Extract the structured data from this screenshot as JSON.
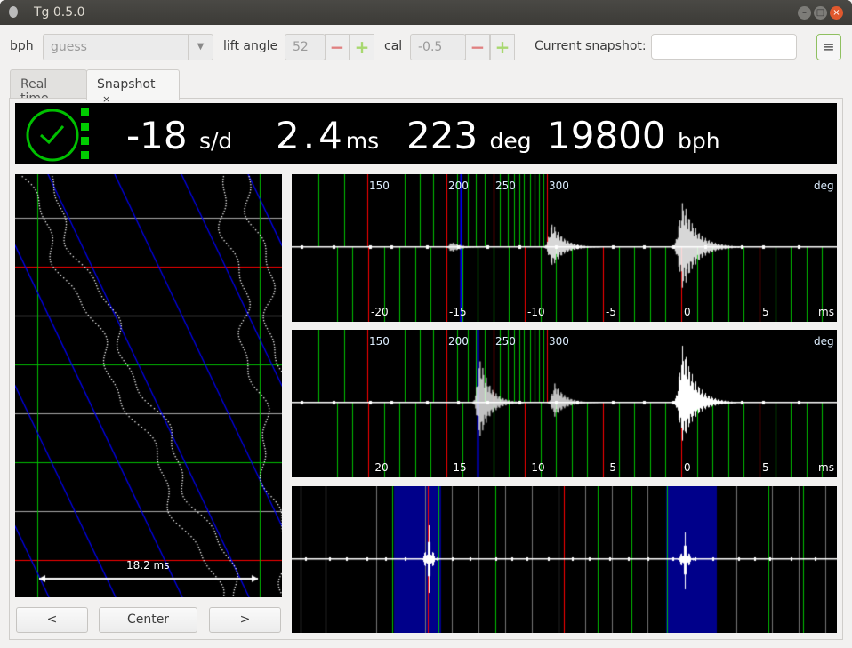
{
  "window": {
    "title": "Tg 0.5.0"
  },
  "toolbar": {
    "bph_label": "bph",
    "bph_value": "guess",
    "lift_angle_label": "lift angle",
    "lift_angle_value": "52",
    "cal_label": "cal",
    "cal_value": "-0.5",
    "snapshot_label": "Current snapshot:",
    "snapshot_value": "",
    "minus": "−",
    "plus": "+",
    "menu": "≡"
  },
  "tabs": [
    {
      "label": "Real time"
    },
    {
      "label": "Snapshot",
      "close": "×"
    }
  ],
  "status": {
    "rate_value": "-18",
    "rate_unit": "s/d",
    "beat_error_value": "2.4",
    "beat_error_unit": "ms",
    "amplitude_value": "223",
    "amplitude_unit": "deg",
    "bph_value": "19800",
    "bph_unit": "bph",
    "signal_level": 4,
    "ok_color": "#00cc00"
  },
  "paperstrip": {
    "span_label": "18.2 ms"
  },
  "buttons": {
    "prev": "<",
    "center": "Center",
    "next": ">"
  },
  "waveforms": {
    "deg_ticks": [
      "150",
      "200",
      "250",
      "300"
    ],
    "deg_unit": "deg",
    "ms_ticks": [
      "-20",
      "-15",
      "-10",
      "-5",
      "0",
      "5"
    ],
    "ms_unit": "ms"
  }
}
